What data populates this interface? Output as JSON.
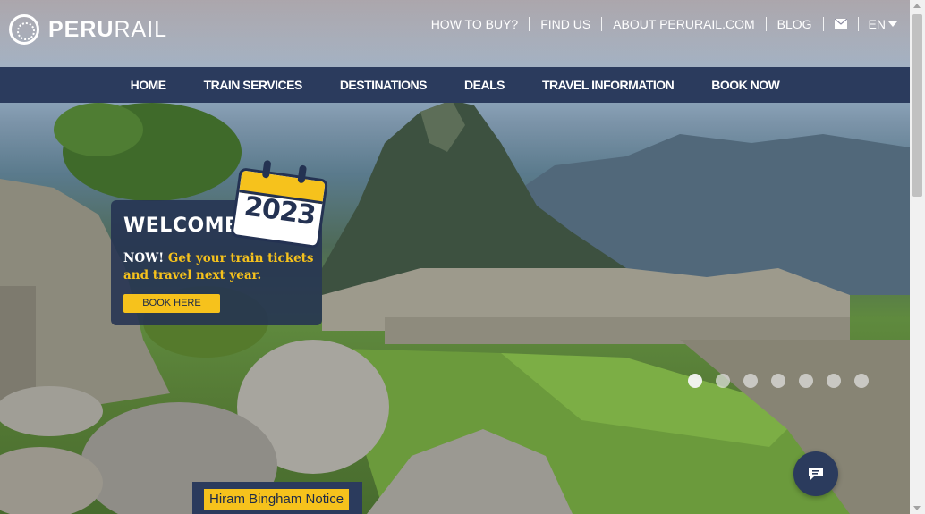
{
  "header": {
    "logo_text_bold": "PERU",
    "logo_text_light": "RAIL",
    "links": [
      "HOW TO BUY?",
      "FIND US",
      "ABOUT PERURAIL.COM",
      "BLOG"
    ],
    "mail_icon": "mail-icon",
    "language": "EN"
  },
  "nav": {
    "items": [
      "HOME",
      "TRAIN SERVICES",
      "DESTINATIONS",
      "DEALS",
      "TRAVEL INFORMATION",
      "BOOK NOW"
    ]
  },
  "hero": {
    "welcome_title": "WELCOME",
    "calendar_year": "2023",
    "promo_lead": "NOW!",
    "promo_text": "Get your train tickets and travel next year.",
    "book_button": "BOOK HERE",
    "slide_count": 7,
    "active_slide": 1
  },
  "notice": {
    "label": "Hiram Bingham Notice"
  },
  "chat": {
    "icon": "chat-icon"
  },
  "colors": {
    "navy": "#2b3b5d",
    "yellow": "#f6c21c"
  }
}
